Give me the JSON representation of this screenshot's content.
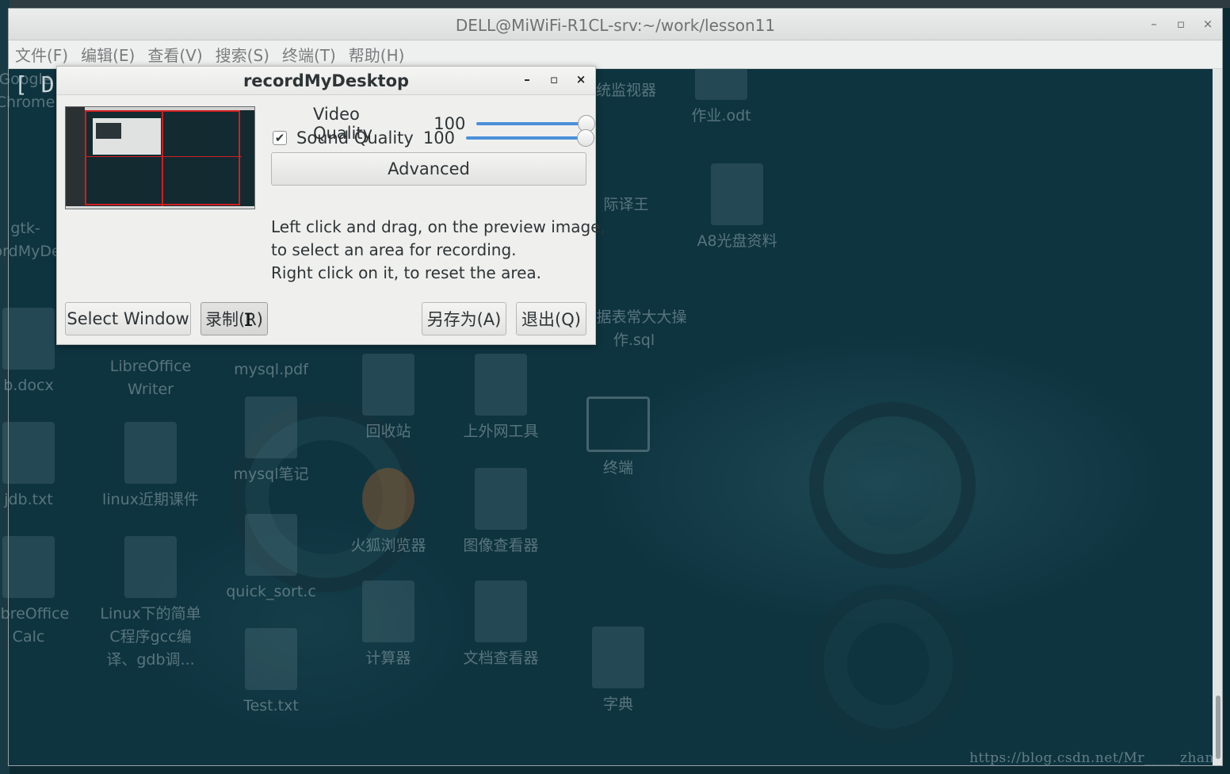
{
  "terminal": {
    "title": "DELL@MiWiFi-R1CL-srv:~/work/lesson11",
    "menu": [
      "文件(F)",
      "编辑(E)",
      "查看(V)",
      "搜索(S)",
      "终端(T)",
      "帮助(H)"
    ],
    "prompt_fragment": "[ DE",
    "wm": {
      "minimize": "–",
      "maximize": "▫",
      "close": "×"
    }
  },
  "desktop_icons": [
    {
      "label": "Google Chrome"
    },
    {
      "label": "gtk-recordMyDesktop"
    },
    {
      "label": "b.docx"
    },
    {
      "label": "jdb.txt"
    },
    {
      "label": "LibreOffice Calc"
    },
    {
      "label": "LibreOffice Writer"
    },
    {
      "label": "linux近期课件"
    },
    {
      "label": "Linux下的简单C程序gcc编译、gdb调..."
    },
    {
      "label": "mysql.pdf"
    },
    {
      "label": "mysql笔记"
    },
    {
      "label": "quick_sort.c"
    },
    {
      "label": "Test.txt"
    },
    {
      "label": "回收站"
    },
    {
      "label": "火狐浏览器"
    },
    {
      "label": "计算器"
    },
    {
      "label": "上外网工具"
    },
    {
      "label": "图像查看器"
    },
    {
      "label": "文档查看器"
    },
    {
      "label": "统监视器"
    },
    {
      "label": "际译王"
    },
    {
      "label": "数据表常大大操作.sql"
    },
    {
      "label": "终端"
    },
    {
      "label": "字典"
    },
    {
      "label": "作业.odt"
    },
    {
      "label": "A8光盘资料"
    }
  ],
  "dialog": {
    "title": "recordMyDesktop",
    "wm": {
      "minimize": "–",
      "maximize": "▫",
      "close": "×"
    },
    "video_quality": {
      "label": "Video Quality",
      "value": "100",
      "level": 1.0
    },
    "sound_quality": {
      "label": "Sound Quality",
      "value": "100",
      "level": 1.0,
      "checked": true
    },
    "advanced_label": "Advanced",
    "help_lines": [
      "Left click and drag, on the preview image,",
      "to select an area for recording.",
      "Right click on it, to reset the area."
    ],
    "buttons": {
      "select_window": "Select Window",
      "record": "录制(R)",
      "save_as": "另存为(A)",
      "quit": "退出(Q)"
    }
  },
  "watermark": "https://blog.csdn.net/Mr_____zhan",
  "colors": {
    "accent": "#4a90d9",
    "selection": "#cf1f1f"
  }
}
